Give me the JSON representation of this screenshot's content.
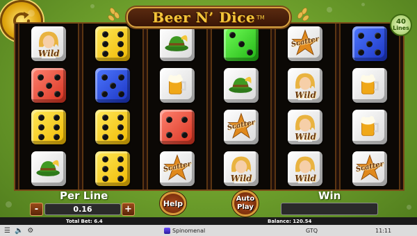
{
  "game": {
    "title": "Beer N’ Dice",
    "trademark": "TM"
  },
  "lines_badge": {
    "number": "40",
    "label": "Lines"
  },
  "reels": [
    [
      {
        "type": "wild"
      },
      {
        "type": "die",
        "color": "red",
        "face": 5
      },
      {
        "type": "die",
        "color": "yellow",
        "face": 6
      },
      {
        "type": "hat"
      }
    ],
    [
      {
        "type": "die",
        "color": "yellow",
        "face": 6
      },
      {
        "type": "die",
        "color": "blue",
        "face": 5
      },
      {
        "type": "die",
        "color": "yellow",
        "face": 6
      },
      {
        "type": "die",
        "color": "yellow",
        "face": 6
      }
    ],
    [
      {
        "type": "hat"
      },
      {
        "type": "beer"
      },
      {
        "type": "die",
        "color": "red",
        "face": 4
      },
      {
        "type": "scatter"
      }
    ],
    [
      {
        "type": "die",
        "color": "green",
        "face": 3
      },
      {
        "type": "hat"
      },
      {
        "type": "scatter"
      },
      {
        "type": "wild"
      }
    ],
    [
      {
        "type": "scatter"
      },
      {
        "type": "wild"
      },
      {
        "type": "wild"
      },
      {
        "type": "wild"
      }
    ],
    [
      {
        "type": "die",
        "color": "blue",
        "face": 5
      },
      {
        "type": "beer"
      },
      {
        "type": "beer"
      },
      {
        "type": "scatter"
      }
    ]
  ],
  "symbol_labels": {
    "wild": "Wild",
    "scatter": "Scatter"
  },
  "controls": {
    "per_line_label": "Per Line",
    "per_line_value": "0.16",
    "minus": "-",
    "plus": "+",
    "help": "Help",
    "auto_play": "Auto Play",
    "win_label": "Win"
  },
  "status": {
    "total_bet": "Total Bet: 6.4",
    "balance": "Balance: 120.54"
  },
  "bottom_bar": {
    "brand": "Spinomenal",
    "currency": "GTQ",
    "time": "11:11"
  }
}
